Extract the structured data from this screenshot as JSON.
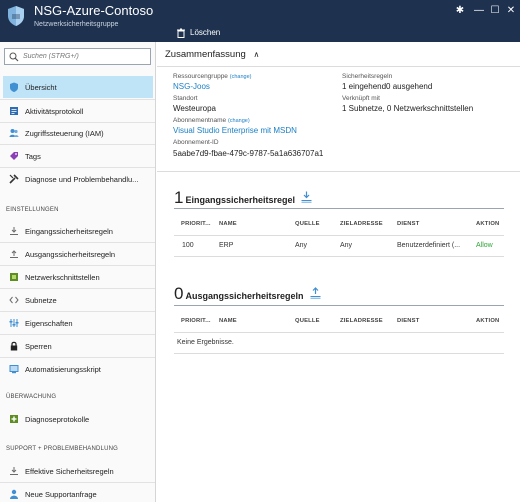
{
  "window": {
    "title": "NSG-Azure-Contoso",
    "subtitle": "Netzwerksicherheitsgruppe",
    "pin": "✱",
    "minimize": "—",
    "maximize": "☐",
    "close": "✕"
  },
  "toolbar": {
    "delete_label": "Löschen"
  },
  "sidebar": {
    "search_placeholder": "Suchen (STRG+/)",
    "items": [
      {
        "label": "Übersicht"
      },
      {
        "label": "Aktivitätsprotokoll"
      },
      {
        "label": "Zugriffssteuerung (IAM)"
      },
      {
        "label": "Tags"
      },
      {
        "label": "Diagnose und Problembehandlu..."
      }
    ],
    "settings_label": "EINSTELLUNGEN",
    "settings_items": [
      {
        "label": "Eingangssicherheitsregeln"
      },
      {
        "label": "Ausgangssicherheitsregeln"
      },
      {
        "label": "Netzwerkschnittstellen"
      },
      {
        "label": "Subnetze"
      },
      {
        "label": "Eigenschaften"
      },
      {
        "label": "Sperren"
      },
      {
        "label": "Automatisierungsskript"
      }
    ],
    "monitoring_label": "ÜBERWACHUNG",
    "monitoring_items": [
      {
        "label": "Diagnoseprotokolle"
      }
    ],
    "support_label": "SUPPORT + PROBLEMBEHANDLUNG",
    "support_items": [
      {
        "label": "Effektive Sicherheitsregeln"
      },
      {
        "label": "Neue Supportanfrage"
      }
    ]
  },
  "summary": {
    "heading": "Zusammenfassung",
    "chevron": "∧",
    "resource_group_label": "Ressourcengruppe",
    "change": "(change)",
    "resource_group": "NSG-Joos",
    "location_label": "Standort",
    "location": "Westeuropa",
    "subscription_name_label": "Abonnementname",
    "subscription_name": "Visual Studio Enterprise mit MSDN",
    "subscription_id_label": "Abonnement-ID",
    "subscription_id": "5aabe7d9-fbae-479c-9787-5a1a636707a1",
    "security_rules_label": "Sicherheitsregeln",
    "security_rules": "1 eingehend0 ausgehend",
    "associated_label": "Verknüpft mit",
    "associated": "1 Subnetze, 0 Netzwerkschnittstellen"
  },
  "inbound": {
    "count": "1",
    "title": "Eingangssicherheitsregel",
    "columns": {
      "priority": "PRIORIT...",
      "name": "NAME",
      "source": "QUELLE",
      "destination": "ZIELADRESSE",
      "service": "DIENST",
      "action": "AKTION"
    },
    "rows": [
      {
        "priority": "100",
        "name": "ERP",
        "source": "Any",
        "destination": "Any",
        "service": "Benutzerdefiniert (...",
        "action": "Allow"
      }
    ]
  },
  "outbound": {
    "count": "0",
    "title": "Ausgangssicherheitsregeln",
    "columns": {
      "priority": "PRIORIT...",
      "name": "NAME",
      "source": "QUELLE",
      "destination": "ZIELADRESSE",
      "service": "DIENST",
      "action": "AKTION"
    },
    "empty_text": "Keine Ergebnisse."
  },
  "colors": {
    "titlebar": "#1e3250",
    "accent": "#1a7fc5",
    "active_nav": "#bfe4f7",
    "allow": "#2fa537"
  }
}
